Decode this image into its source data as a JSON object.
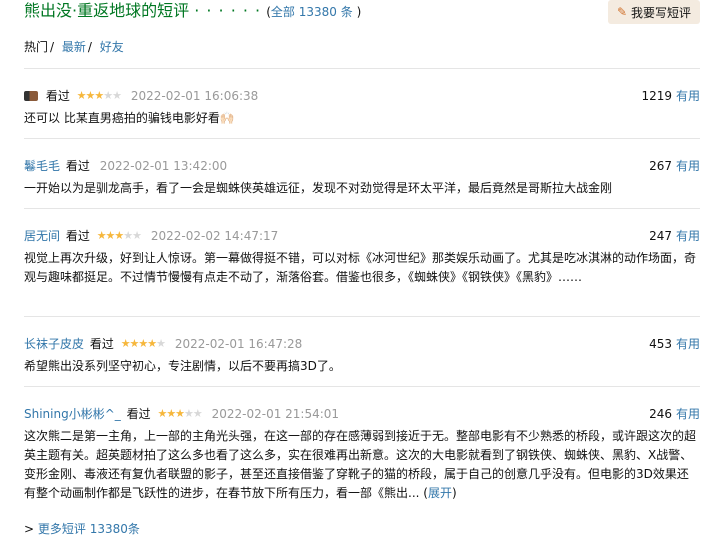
{
  "header": {
    "title": "熊出没·重返地球的短评",
    "dots": "· · · · · ·",
    "total_open": "(",
    "total_link": "全部 13380 条",
    "total_close": ")",
    "write_button": "我要写短评"
  },
  "tabs": [
    {
      "label": "热门",
      "sep": "/"
    },
    {
      "label": "最新",
      "sep": "/"
    },
    {
      "label": "好友",
      "sep": ""
    }
  ],
  "reviews": [
    {
      "user": "",
      "status": "看过",
      "rating": 3,
      "time": "2022-02-01 16:06:38",
      "votes": "1219",
      "useful_label": "有用",
      "text": "还可以 比某直男癌拍的骗钱电影好看🙌🏻",
      "expand": ""
    },
    {
      "user": "鬈毛毛",
      "status": "看过",
      "rating": 0,
      "time": "2022-02-01 13:42:00",
      "votes": "267",
      "useful_label": "有用",
      "text": "一开始以为是驯龙高手，看了一会是蜘蛛侠英雄远征，发现不对劲觉得是环太平洋，最后竟然是哥斯拉大战金刚",
      "expand": ""
    },
    {
      "user": "居无间",
      "status": "看过",
      "rating": 3,
      "time": "2022-02-02 14:47:17",
      "votes": "247",
      "useful_label": "有用",
      "text": "视觉上再次升级，好到让人惊讶。第一幕做得挺不错，可以对标《冰河世纪》那类娱乐动画了。尤其是吃冰淇淋的动作场面，奇观与趣味都挺足。不过情节慢慢有点走不动了，渐落俗套。借鉴也很多，《蜘蛛侠》《钢铁侠》《黑豹》……",
      "expand": ""
    },
    {
      "user": "长袜子皮皮",
      "status": "看过",
      "rating": 4,
      "time": "2022-02-01 16:47:28",
      "votes": "453",
      "useful_label": "有用",
      "text": "希望熊出没系列坚守初心，专注剧情，以后不要再搞3D了。",
      "expand": ""
    },
    {
      "user": "Shining小彬彬^_",
      "status": "看过",
      "rating": 3,
      "time": "2022-02-01 21:54:01",
      "votes": "246",
      "useful_label": "有用",
      "text": "这次熊二是第一主角，上一部的主角光头强，在这一部的存在感薄弱到接近于无。整部电影有不少熟悉的桥段，或许跟这次的超英主题有关。超英题材拍了这么多也看了这么多，实在很难再出新意。这次的大电影就看到了钢铁侠、蜘蛛侠、黑豹、X战警、变形金刚、毒液还有复仇者联盟的影子，甚至还直接借鉴了穿靴子的猫的桥段，属于自己的创意几乎没有。但电影的3D效果还有整个动画制作都是飞跃性的进步，在春节放下所有压力，看一部《熊出... (",
      "expand": "展开",
      "expand_close": ")"
    }
  ],
  "more": {
    "prefix": ">",
    "link": "更多短评 13380条"
  },
  "colors": {
    "title_green": "#007722",
    "link_blue": "#3377aa",
    "star_gold": "#f6b73c",
    "time_gray": "#999999",
    "button_bg": "#f4ebe0"
  }
}
